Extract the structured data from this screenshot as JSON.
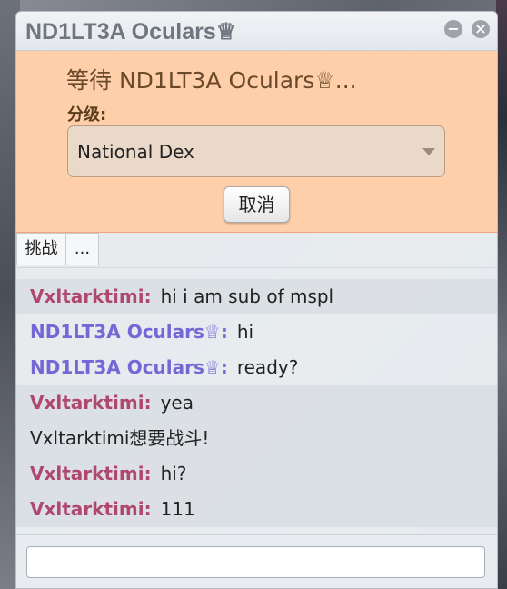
{
  "window": {
    "title": "ND1LT3A Oculars♕"
  },
  "challenge": {
    "waiting_text": "等待 ND1LT3A Oculars♕...",
    "format_label": "分级:",
    "format_value": "National Dex",
    "cancel_label": "取消"
  },
  "tabs": [
    {
      "label": "挑战"
    },
    {
      "label": "..."
    }
  ],
  "messages": [
    {
      "sender": "Vxltarktimi:",
      "text": "hi i am sub of mspl"
    },
    {
      "sender": "ND1LT3A Oculars♕:",
      "text": "hi"
    },
    {
      "sender": "ND1LT3A Oculars♕:",
      "text": "ready?"
    },
    {
      "sender": "Vxltarktimi:",
      "text": "yea"
    },
    {
      "notice": "Vxltarktimi想要战斗!"
    },
    {
      "sender": "Vxltarktimi:",
      "text": "hi?"
    },
    {
      "sender": "Vxltarktimi:",
      "text": "111"
    }
  ],
  "colors": {
    "challenge_bg": "#ffcfa9",
    "sender_red": "#b0476f",
    "sender_purple": "#7467d6"
  },
  "icons": {
    "minimize": "minimize-icon",
    "close": "close-icon",
    "dropdown": "chevron-down-icon"
  },
  "composer": {
    "value": ""
  }
}
